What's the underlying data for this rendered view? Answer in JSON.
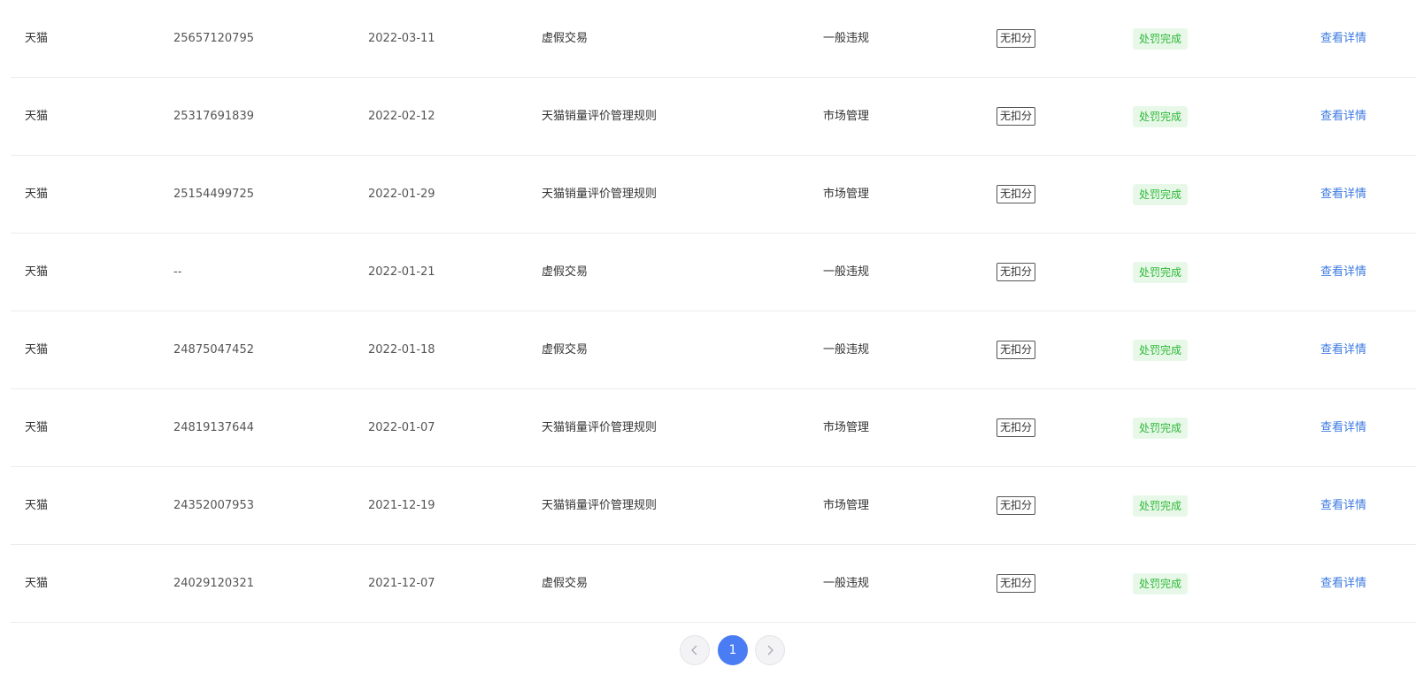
{
  "table": {
    "rows": [
      {
        "platform": "天猫",
        "id": "25657120795",
        "date": "2022-03-11",
        "rule": "虚假交易",
        "type": "一般违规",
        "score": "无扣分",
        "status": "处罚完成",
        "action": "查看详情"
      },
      {
        "platform": "天猫",
        "id": "25317691839",
        "date": "2022-02-12",
        "rule": "天猫销量评价管理规则",
        "type": "市场管理",
        "score": "无扣分",
        "status": "处罚完成",
        "action": "查看详情"
      },
      {
        "platform": "天猫",
        "id": "25154499725",
        "date": "2022-01-29",
        "rule": "天猫销量评价管理规则",
        "type": "市场管理",
        "score": "无扣分",
        "status": "处罚完成",
        "action": "查看详情"
      },
      {
        "platform": "天猫",
        "id": "--",
        "date": "2022-01-21",
        "rule": "虚假交易",
        "type": "一般违规",
        "score": "无扣分",
        "status": "处罚完成",
        "action": "查看详情"
      },
      {
        "platform": "天猫",
        "id": "24875047452",
        "date": "2022-01-18",
        "rule": "虚假交易",
        "type": "一般违规",
        "score": "无扣分",
        "status": "处罚完成",
        "action": "查看详情"
      },
      {
        "platform": "天猫",
        "id": "24819137644",
        "date": "2022-01-07",
        "rule": "天猫销量评价管理规则",
        "type": "市场管理",
        "score": "无扣分",
        "status": "处罚完成",
        "action": "查看详情"
      },
      {
        "platform": "天猫",
        "id": "24352007953",
        "date": "2021-12-19",
        "rule": "天猫销量评价管理规则",
        "type": "市场管理",
        "score": "无扣分",
        "status": "处罚完成",
        "action": "查看详情"
      },
      {
        "platform": "天猫",
        "id": "24029120321",
        "date": "2021-12-07",
        "rule": "虚假交易",
        "type": "一般违规",
        "score": "无扣分",
        "status": "处罚完成",
        "action": "查看详情"
      }
    ]
  },
  "pagination": {
    "prev_icon": "chevron-left-icon",
    "current_page": "1",
    "next_icon": "chevron-right-icon"
  },
  "colors": {
    "status_text": "#2fb83a",
    "status_bg": "#e8f8e8",
    "link": "#3d7ae0",
    "page_active": "#4a7cf3"
  }
}
